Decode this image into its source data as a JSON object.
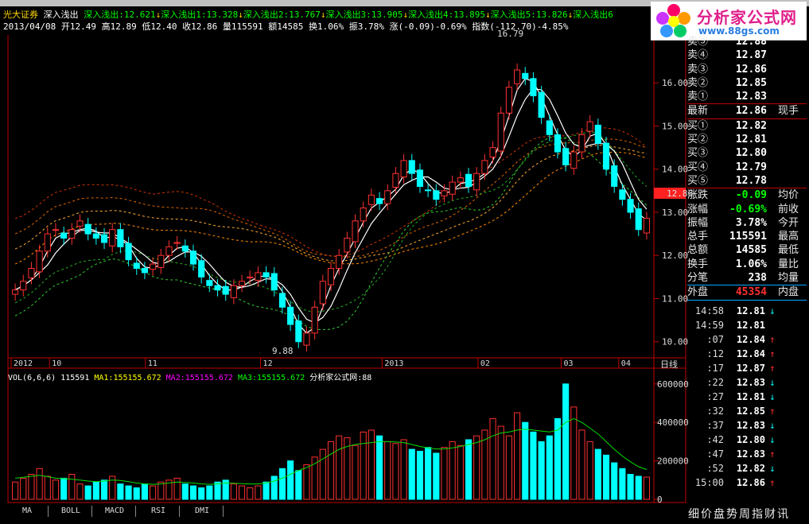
{
  "header": {
    "broker": "光大证券",
    "indicator_name": "深入浅出",
    "ma_items": [
      {
        "label": "深入浅出:12.621",
        "arrow": "↓"
      },
      {
        "label": "深入浅出1:13.328",
        "arrow": "↓"
      },
      {
        "label": "深入浅出2:13.767",
        "arrow": "↓"
      },
      {
        "label": "深入浅出3:13.905",
        "arrow": "↓"
      },
      {
        "label": "深入浅出4:13.895",
        "arrow": "↓"
      },
      {
        "label": "深入浅出5:13.826",
        "arrow": "↓"
      },
      {
        "label": "深入浅出6",
        "arrow": ""
      }
    ],
    "date": "2013/04/08",
    "open": "开12.49",
    "high": "高12.89",
    "low": "低12.40",
    "close": "收12.86",
    "volume": "量115591",
    "amount": "额14585",
    "turnover": "换1.06%",
    "amplitude": "振3.78%",
    "change": "涨(-0.09)-0.69%",
    "index_change": "指数(-112.70)-4.85%"
  },
  "logo": {
    "text": "分析家公式网",
    "url": "www.88gs.com"
  },
  "chart_data": [
    {
      "type": "candlestick",
      "title": "",
      "y_ticks": [
        "16.00",
        "15.00",
        "14.00",
        "13.00",
        "12.00",
        "11.00",
        "10.00"
      ],
      "x_ticks": [
        "2012",
        "10",
        "11",
        "12",
        "2013",
        "02",
        "03",
        "04"
      ],
      "ylim": [
        9.7,
        17.0
      ],
      "annotations": [
        {
          "text": "16.79",
          "value": 16.79
        },
        {
          "text": "9.88",
          "value": 9.88
        }
      ],
      "current_price_tag": "12.86",
      "period_label": "日线",
      "close": [
        11.2,
        11.4,
        11.7,
        12.1,
        12.5,
        12.6,
        12.4,
        12.6,
        12.8,
        12.5,
        12.4,
        12.3,
        12.6,
        12.2,
        11.9,
        11.7,
        11.6,
        11.8,
        12.0,
        12.2,
        12.3,
        12.1,
        11.8,
        11.5,
        11.3,
        11.2,
        11.1,
        11.3,
        11.4,
        11.5,
        11.6,
        11.5,
        11.2,
        10.8,
        10.4,
        10.0,
        10.2,
        10.8,
        11.4,
        11.7,
        12.0,
        12.4,
        12.8,
        13.1,
        13.4,
        13.2,
        13.5,
        13.9,
        14.2,
        13.9,
        13.6,
        13.5,
        13.3,
        13.5,
        13.7,
        13.8,
        13.6,
        13.9,
        14.2,
        14.5,
        15.3,
        15.9,
        16.3,
        16.1,
        15.7,
        15.2,
        14.8,
        14.4,
        14.1,
        14.4,
        14.8,
        15.1,
        14.6,
        14.0,
        13.6,
        13.3,
        13.0,
        12.6,
        12.86
      ]
    },
    {
      "type": "bar",
      "title": "",
      "legend": [
        {
          "text": "VOL(6,6,6) 115591",
          "color": "#ffffff"
        },
        {
          "text": "MA1:155155.672",
          "color": "#ffff00"
        },
        {
          "text": "MA2:155155.672",
          "color": "#ff00ff"
        },
        {
          "text": "MA3:155155.672",
          "color": "#00ff00"
        },
        {
          "text": "分析家公式网:88",
          "color": "#ffffff"
        }
      ],
      "y_ticks": [
        "600000",
        "400000",
        "200000",
        "0"
      ],
      "ylim": [
        0,
        620000
      ],
      "values": [
        90000,
        110000,
        130000,
        160000,
        120000,
        100000,
        110000,
        130000,
        80000,
        70000,
        90000,
        100000,
        120000,
        80000,
        70000,
        60000,
        80000,
        70000,
        90000,
        100000,
        110000,
        80000,
        70000,
        60000,
        70000,
        90000,
        100000,
        80000,
        70000,
        60000,
        70000,
        90000,
        120000,
        160000,
        200000,
        150000,
        180000,
        220000,
        260000,
        300000,
        330000,
        320000,
        280000,
        350000,
        360000,
        330000,
        300000,
        290000,
        310000,
        260000,
        250000,
        270000,
        240000,
        270000,
        300000,
        280000,
        310000,
        330000,
        360000,
        420000,
        380000,
        330000,
        450000,
        400000,
        350000,
        300000,
        330000,
        420000,
        600000,
        480000,
        360000,
        300000,
        260000,
        230000,
        190000,
        160000,
        130000,
        120000,
        115591
      ],
      "ma_line": [
        110000,
        115000,
        120000,
        125000,
        118000,
        110000,
        108000,
        105000,
        100000,
        95000,
        92000,
        95000,
        100000,
        98000,
        92000,
        85000,
        80000,
        78000,
        80000,
        85000,
        90000,
        88000,
        85000,
        80000,
        78000,
        80000,
        85000,
        84000,
        82000,
        80000,
        80000,
        85000,
        95000,
        110000,
        130000,
        150000,
        165000,
        185000,
        210000,
        235000,
        260000,
        275000,
        285000,
        290000,
        295000,
        300000,
        300000,
        298000,
        295000,
        285000,
        275000,
        268000,
        262000,
        262000,
        268000,
        275000,
        285000,
        295000,
        310000,
        330000,
        345000,
        350000,
        360000,
        365000,
        360000,
        355000,
        350000,
        360000,
        400000,
        420000,
        400000,
        370000,
        340000,
        300000,
        260000,
        225000,
        195000,
        170000,
        155156
      ]
    }
  ],
  "quote": {
    "sell": [
      {
        "label": "卖⑤",
        "price": "12.88"
      },
      {
        "label": "卖④",
        "price": "12.87"
      },
      {
        "label": "卖③",
        "price": "12.86"
      },
      {
        "label": "卖②",
        "price": "12.85"
      },
      {
        "label": "卖①",
        "price": "12.83"
      }
    ],
    "latest": {
      "label": "最新",
      "price": "12.86",
      "right": "现手"
    },
    "buy": [
      {
        "label": "买①",
        "price": "12.82"
      },
      {
        "label": "买②",
        "price": "12.81"
      },
      {
        "label": "买③",
        "price": "12.80"
      },
      {
        "label": "买④",
        "price": "12.79"
      },
      {
        "label": "买⑤",
        "price": "12.78"
      }
    ],
    "stats": [
      {
        "label": "涨跌",
        "value": "-0.09",
        "right": "均价",
        "color": "#00ff00"
      },
      {
        "label": "涨幅",
        "value": "-0.69%",
        "right": "前收",
        "color": "#00ff00"
      },
      {
        "label": "振幅",
        "value": "3.78%",
        "right": "今开",
        "color": "#ffffff"
      },
      {
        "label": "总手",
        "value": "115591",
        "right": "最高",
        "color": "#ffffff"
      },
      {
        "label": "总额",
        "value": "14585",
        "right": "最低",
        "color": "#ffffff"
      },
      {
        "label": "换手",
        "value": "1.06%",
        "right": "量比",
        "color": "#ffffff"
      },
      {
        "label": "分笔",
        "value": "238",
        "right": "均量",
        "color": "#ffffff"
      },
      {
        "label": "外盘",
        "value": "45354",
        "right": "内盘",
        "color": "#ff3030"
      }
    ],
    "ticks": [
      {
        "time": "14:58",
        "price": "12.81",
        "arrow": "↓",
        "color": "#00ffff"
      },
      {
        "time": "14:59",
        "price": "12.81",
        "arrow": "",
        "color": "#00ffff"
      },
      {
        "time": ":07",
        "price": "12.84",
        "arrow": "↑",
        "color": "#ff3030"
      },
      {
        "time": ":12",
        "price": "12.84",
        "arrow": "↑",
        "color": "#ff3030"
      },
      {
        "time": ":17",
        "price": "12.87",
        "arrow": "↑",
        "color": "#ff3030"
      },
      {
        "time": ":22",
        "price": "12.83",
        "arrow": "↓",
        "color": "#00ffff"
      },
      {
        "time": ":27",
        "price": "12.81",
        "arrow": "↓",
        "color": "#00ffff"
      },
      {
        "time": ":32",
        "price": "12.85",
        "arrow": "↑",
        "color": "#ff3030"
      },
      {
        "time": ":37",
        "price": "12.83",
        "arrow": "↓",
        "color": "#00ffff"
      },
      {
        "time": ":42",
        "price": "12.80",
        "arrow": "↓",
        "color": "#00ffff"
      },
      {
        "time": ":47",
        "price": "12.83",
        "arrow": "↑",
        "color": "#ff3030"
      },
      {
        "time": ":52",
        "price": "12.82",
        "arrow": "↓",
        "color": "#00ffff"
      },
      {
        "time": "15:00",
        "price": "12.86",
        "arrow": "↑",
        "color": "#ff3030"
      }
    ]
  },
  "bottom_tabs": [
    "MA",
    "BOLL",
    "MACD",
    "RSI",
    "DMI"
  ],
  "bottom_links": "细价盘势周指财讯",
  "colors": {
    "up": "#ff3030",
    "down": "#00ffff",
    "axis": "#c00000"
  }
}
